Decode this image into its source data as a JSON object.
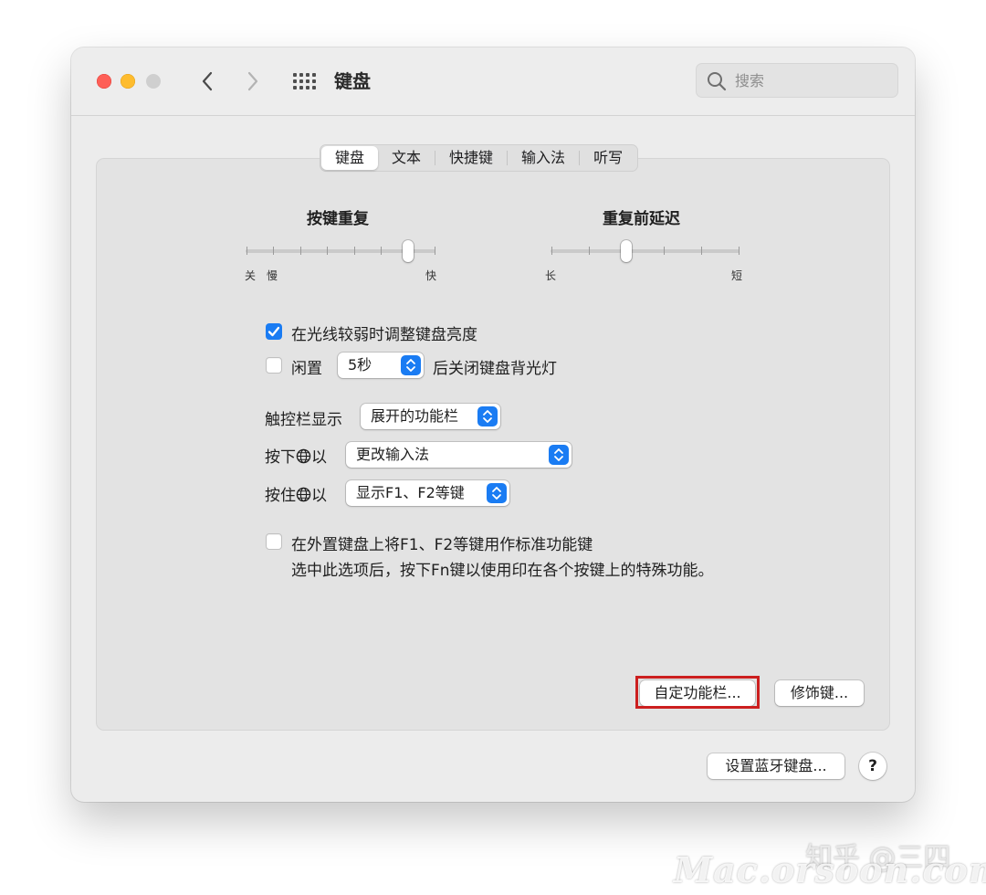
{
  "window": {
    "title": "键盘",
    "search": {
      "placeholder": "搜索",
      "value": ""
    }
  },
  "tabs": [
    {
      "label": "键盘",
      "active": true
    },
    {
      "label": "文本",
      "active": false
    },
    {
      "label": "快捷键",
      "active": false
    },
    {
      "label": "输入法",
      "active": false
    },
    {
      "label": "听写",
      "active": false
    }
  ],
  "key_repeat": {
    "label": "按键重复",
    "min_label": "关",
    "slow_label": "慢",
    "max_label": "快",
    "level": 0.86
  },
  "repeat_delay": {
    "label": "重复前延迟",
    "min_label": "长",
    "max_label": "短",
    "level": 0.4
  },
  "options": {
    "adjust_brightness": {
      "label": "在光线较弱时调整键盘亮度",
      "checked": true
    },
    "idle_off": {
      "label_before": "闲置",
      "select_value": "5秒",
      "label_after": "后关闭键盘背光灯",
      "checked": false
    }
  },
  "touch_bar": {
    "label": "触控栏显示",
    "value": "展开的功能栏"
  },
  "press_globe": {
    "label_before": "按下",
    "label_after": "以",
    "value": "更改输入法"
  },
  "hold_globe": {
    "label_before": "按住",
    "label_after": "以",
    "value": "显示F1、F2等键"
  },
  "fn_keys": {
    "label": "在外置键盘上将F1、F2等键用作标准功能键",
    "description": "选中此选项后，按下Fn键以使用印在各个按键上的特殊功能。",
    "checked": false
  },
  "buttons": {
    "customize_touch_bar": "自定功能栏...",
    "modifier_keys": "修饰键...",
    "bluetooth_keyboard": "设置蓝牙键盘...",
    "help": "?"
  },
  "colors": {
    "accent": "#1a7cf3",
    "highlight": "#cc1f1f"
  },
  "watermark": {
    "zhihu": "知乎 @三四",
    "site": "Mac.orsoon.com"
  }
}
